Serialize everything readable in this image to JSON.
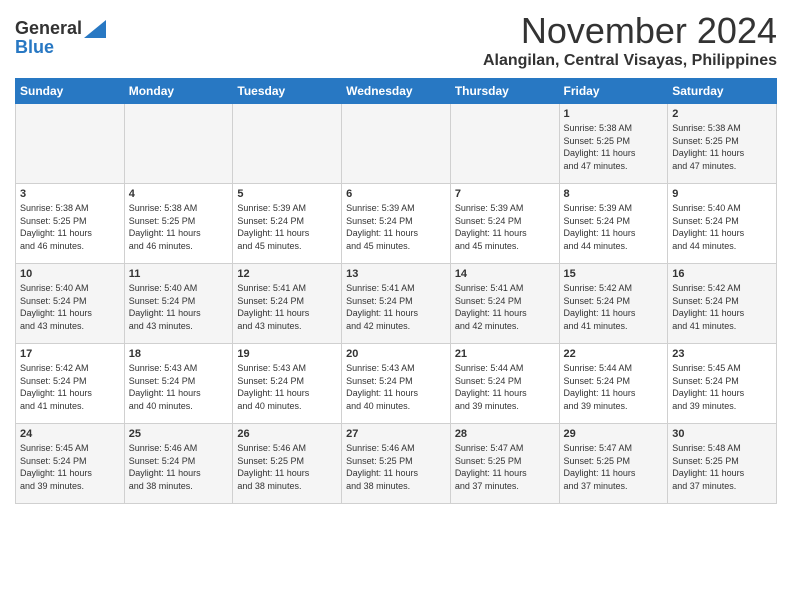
{
  "header": {
    "logo_general": "General",
    "logo_blue": "Blue",
    "month_title": "November 2024",
    "location": "Alangilan, Central Visayas, Philippines"
  },
  "weekdays": [
    "Sunday",
    "Monday",
    "Tuesday",
    "Wednesday",
    "Thursday",
    "Friday",
    "Saturday"
  ],
  "weeks": [
    [
      {
        "day": "",
        "info": ""
      },
      {
        "day": "",
        "info": ""
      },
      {
        "day": "",
        "info": ""
      },
      {
        "day": "",
        "info": ""
      },
      {
        "day": "",
        "info": ""
      },
      {
        "day": "1",
        "info": "Sunrise: 5:38 AM\nSunset: 5:25 PM\nDaylight: 11 hours\nand 47 minutes."
      },
      {
        "day": "2",
        "info": "Sunrise: 5:38 AM\nSunset: 5:25 PM\nDaylight: 11 hours\nand 47 minutes."
      }
    ],
    [
      {
        "day": "3",
        "info": "Sunrise: 5:38 AM\nSunset: 5:25 PM\nDaylight: 11 hours\nand 46 minutes."
      },
      {
        "day": "4",
        "info": "Sunrise: 5:38 AM\nSunset: 5:25 PM\nDaylight: 11 hours\nand 46 minutes."
      },
      {
        "day": "5",
        "info": "Sunrise: 5:39 AM\nSunset: 5:24 PM\nDaylight: 11 hours\nand 45 minutes."
      },
      {
        "day": "6",
        "info": "Sunrise: 5:39 AM\nSunset: 5:24 PM\nDaylight: 11 hours\nand 45 minutes."
      },
      {
        "day": "7",
        "info": "Sunrise: 5:39 AM\nSunset: 5:24 PM\nDaylight: 11 hours\nand 45 minutes."
      },
      {
        "day": "8",
        "info": "Sunrise: 5:39 AM\nSunset: 5:24 PM\nDaylight: 11 hours\nand 44 minutes."
      },
      {
        "day": "9",
        "info": "Sunrise: 5:40 AM\nSunset: 5:24 PM\nDaylight: 11 hours\nand 44 minutes."
      }
    ],
    [
      {
        "day": "10",
        "info": "Sunrise: 5:40 AM\nSunset: 5:24 PM\nDaylight: 11 hours\nand 43 minutes."
      },
      {
        "day": "11",
        "info": "Sunrise: 5:40 AM\nSunset: 5:24 PM\nDaylight: 11 hours\nand 43 minutes."
      },
      {
        "day": "12",
        "info": "Sunrise: 5:41 AM\nSunset: 5:24 PM\nDaylight: 11 hours\nand 43 minutes."
      },
      {
        "day": "13",
        "info": "Sunrise: 5:41 AM\nSunset: 5:24 PM\nDaylight: 11 hours\nand 42 minutes."
      },
      {
        "day": "14",
        "info": "Sunrise: 5:41 AM\nSunset: 5:24 PM\nDaylight: 11 hours\nand 42 minutes."
      },
      {
        "day": "15",
        "info": "Sunrise: 5:42 AM\nSunset: 5:24 PM\nDaylight: 11 hours\nand 41 minutes."
      },
      {
        "day": "16",
        "info": "Sunrise: 5:42 AM\nSunset: 5:24 PM\nDaylight: 11 hours\nand 41 minutes."
      }
    ],
    [
      {
        "day": "17",
        "info": "Sunrise: 5:42 AM\nSunset: 5:24 PM\nDaylight: 11 hours\nand 41 minutes."
      },
      {
        "day": "18",
        "info": "Sunrise: 5:43 AM\nSunset: 5:24 PM\nDaylight: 11 hours\nand 40 minutes."
      },
      {
        "day": "19",
        "info": "Sunrise: 5:43 AM\nSunset: 5:24 PM\nDaylight: 11 hours\nand 40 minutes."
      },
      {
        "day": "20",
        "info": "Sunrise: 5:43 AM\nSunset: 5:24 PM\nDaylight: 11 hours\nand 40 minutes."
      },
      {
        "day": "21",
        "info": "Sunrise: 5:44 AM\nSunset: 5:24 PM\nDaylight: 11 hours\nand 39 minutes."
      },
      {
        "day": "22",
        "info": "Sunrise: 5:44 AM\nSunset: 5:24 PM\nDaylight: 11 hours\nand 39 minutes."
      },
      {
        "day": "23",
        "info": "Sunrise: 5:45 AM\nSunset: 5:24 PM\nDaylight: 11 hours\nand 39 minutes."
      }
    ],
    [
      {
        "day": "24",
        "info": "Sunrise: 5:45 AM\nSunset: 5:24 PM\nDaylight: 11 hours\nand 39 minutes."
      },
      {
        "day": "25",
        "info": "Sunrise: 5:46 AM\nSunset: 5:24 PM\nDaylight: 11 hours\nand 38 minutes."
      },
      {
        "day": "26",
        "info": "Sunrise: 5:46 AM\nSunset: 5:25 PM\nDaylight: 11 hours\nand 38 minutes."
      },
      {
        "day": "27",
        "info": "Sunrise: 5:46 AM\nSunset: 5:25 PM\nDaylight: 11 hours\nand 38 minutes."
      },
      {
        "day": "28",
        "info": "Sunrise: 5:47 AM\nSunset: 5:25 PM\nDaylight: 11 hours\nand 37 minutes."
      },
      {
        "day": "29",
        "info": "Sunrise: 5:47 AM\nSunset: 5:25 PM\nDaylight: 11 hours\nand 37 minutes."
      },
      {
        "day": "30",
        "info": "Sunrise: 5:48 AM\nSunset: 5:25 PM\nDaylight: 11 hours\nand 37 minutes."
      }
    ]
  ]
}
